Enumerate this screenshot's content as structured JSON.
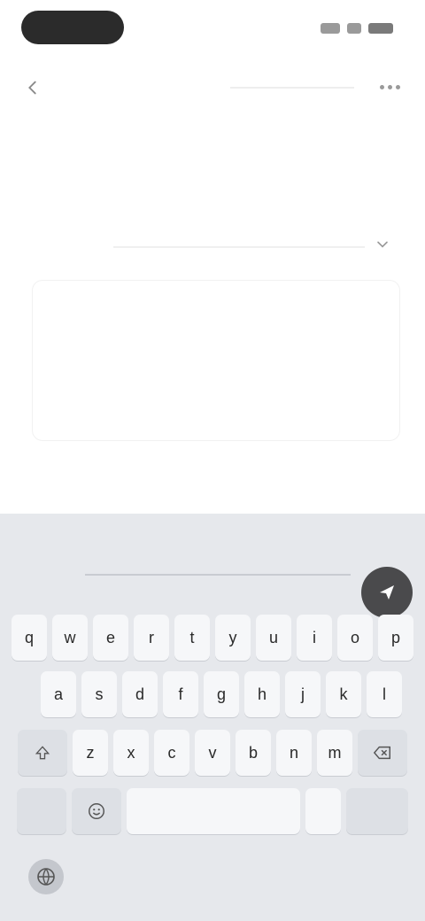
{
  "status_bar": {
    "time": "",
    "icons": [
      "signal-icon",
      "wifi-icon",
      "battery-icon"
    ]
  },
  "header": {
    "app_name": "",
    "back_icon": "back-arrow-icon",
    "more_icon": "more-icon"
  },
  "page": {
    "title": "",
    "subtitle": ""
  },
  "field": {
    "label": "",
    "chevron_icon": "chevron-down-icon"
  },
  "text_card": {
    "placeholder": ""
  },
  "keyboard": {
    "suggestion": "",
    "row1": [
      "q",
      "w",
      "e",
      "r",
      "t",
      "y",
      "u",
      "i",
      "o",
      "p"
    ],
    "row2": [
      "a",
      "s",
      "d",
      "f",
      "g",
      "h",
      "j",
      "k",
      "l"
    ],
    "row3": [
      "z",
      "x",
      "c",
      "v",
      "b",
      "n",
      "m"
    ],
    "row4_left": "",
    "space_label": "",
    "enter_label": ""
  },
  "colors": {
    "status_pill": "#2b2b2b",
    "keyboard_bg": "#e6e8ec",
    "send_button": "#4a4a4c"
  }
}
